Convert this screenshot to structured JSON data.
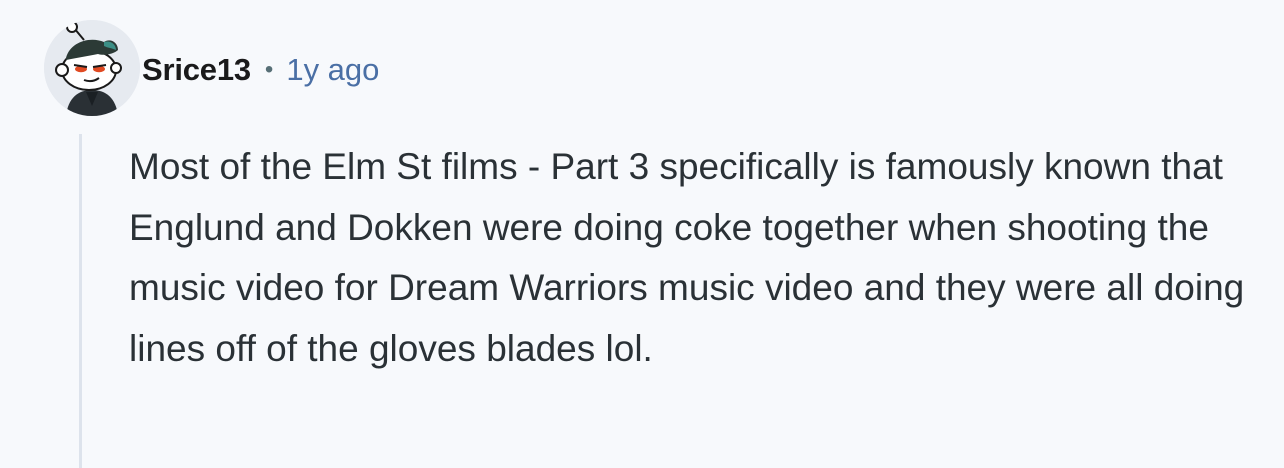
{
  "comment": {
    "author": "Srice13",
    "separator": "•",
    "timestamp": "1y ago",
    "body": "Most of the Elm St films - Part 3 specifically is famously known that Englund and Dokken were doing coke together when shooting the music video for Dream Warriors music video and they were all doing lines off of the gloves blades lol."
  },
  "icons": {
    "avatar": "snoo-avatar-icon"
  },
  "colors": {
    "background": "#f7f9fc",
    "author": "#1a1a1b",
    "timestamp": "#4a6fa5",
    "body_text": "#2a3136",
    "thread_line": "#dde3ec"
  }
}
